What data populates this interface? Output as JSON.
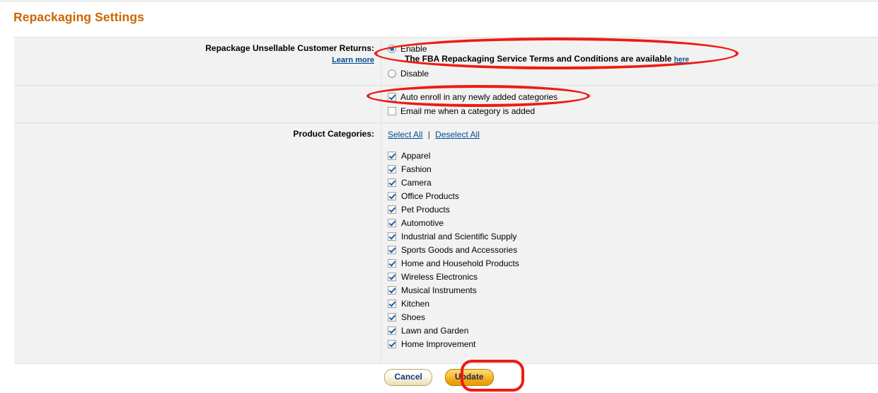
{
  "page": {
    "title": "Repackaging Settings"
  },
  "rows": {
    "repackage": {
      "label": "Repackage Unsellable Customer Returns:",
      "learn_more": "Learn more",
      "options": [
        {
          "value": "enable",
          "label": "Enable",
          "selected": true
        },
        {
          "value": "disable",
          "label": "Disable",
          "selected": false
        }
      ],
      "terms_text": "The FBA Repackaging Service Terms and Conditions are available",
      "terms_link": "here"
    },
    "notifications": {
      "checkboxes": [
        {
          "label": "Auto enroll in any newly added categories",
          "checked": true
        },
        {
          "label": "Email me when a category is added",
          "checked": false
        }
      ]
    },
    "categories": {
      "label": "Product Categories:",
      "select_all": "Select All",
      "separator": "|",
      "deselect_all": "Deselect All",
      "items": [
        {
          "label": "Apparel",
          "checked": true
        },
        {
          "label": "Fashion",
          "checked": true
        },
        {
          "label": "Camera",
          "checked": true
        },
        {
          "label": "Office Products",
          "checked": true
        },
        {
          "label": "Pet Products",
          "checked": true
        },
        {
          "label": "Automotive",
          "checked": true
        },
        {
          "label": "Industrial and Scientific Supply",
          "checked": true
        },
        {
          "label": "Sports Goods and Accessories",
          "checked": true
        },
        {
          "label": "Home and Household Products",
          "checked": true
        },
        {
          "label": "Wireless Electronics",
          "checked": true
        },
        {
          "label": "Musical Instruments",
          "checked": true
        },
        {
          "label": "Kitchen",
          "checked": true
        },
        {
          "label": "Shoes",
          "checked": true
        },
        {
          "label": "Lawn and Garden",
          "checked": true
        },
        {
          "label": "Home Improvement",
          "checked": true
        }
      ]
    }
  },
  "footer": {
    "cancel_label": "Cancel",
    "update_label": "Update"
  },
  "annotations": {
    "color": "#ee1b11",
    "shapes": [
      {
        "name": "terms-highlight",
        "type": "ellipse"
      },
      {
        "name": "auto-enroll-highlight",
        "type": "ellipse"
      },
      {
        "name": "update-button-highlight",
        "type": "rounded-rect"
      }
    ]
  },
  "theme": {
    "title_color": "#cc6600",
    "link_color": "#004b91",
    "row_bg": "#f2f2f2"
  }
}
